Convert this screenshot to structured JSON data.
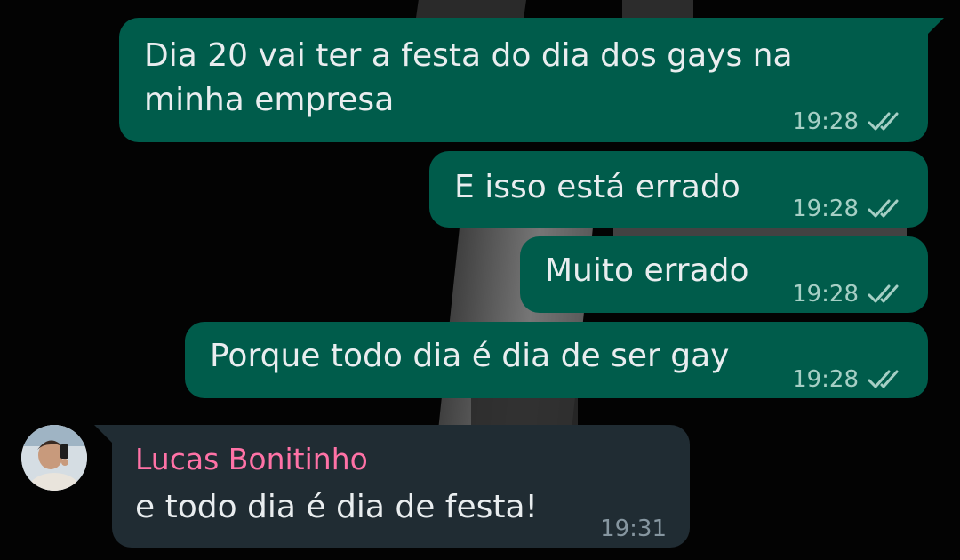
{
  "chat": {
    "outgoing": [
      {
        "text_line1": "Dia 20 vai ter a festa do dia dos gays na",
        "text_line2": "minha empresa",
        "time": "19:28"
      },
      {
        "text": "E isso está errado",
        "time": "19:28"
      },
      {
        "text": "Muito errado",
        "time": "19:28"
      },
      {
        "text": "Porque todo dia é dia de ser gay",
        "time": "19:28"
      }
    ],
    "incoming": {
      "sender": "Lucas Bonitinho",
      "text": "e todo dia é dia de festa!",
      "time": "19:31"
    }
  },
  "colors": {
    "outgoing_bubble": "#005c4b",
    "incoming_bubble": "#202c33",
    "sender_name": "#ff72a6",
    "wallpaper": "#000000"
  },
  "icons": {
    "read_receipt": "double-check-icon",
    "avatar": "avatar"
  }
}
